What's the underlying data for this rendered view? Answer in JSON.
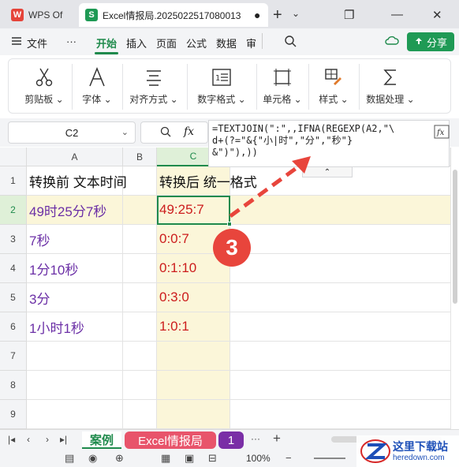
{
  "titlebar": {
    "wps_tab": "WPS Of",
    "doc_tab": "Excel情报局.2025022517080013",
    "modified_dot": "●",
    "new_tab": "+",
    "chevron": "⌄"
  },
  "menu": {
    "items": [
      "文件",
      "···",
      "开始",
      "插入",
      "页面",
      "公式",
      "数据",
      "审"
    ],
    "active": "开始",
    "share": "分享"
  },
  "ribbon": {
    "groups": [
      "剪贴板",
      "字体",
      "对齐方式",
      "数字格式",
      "单元格",
      "样式",
      "数据处理"
    ],
    "caret": "⌄"
  },
  "formula_bar": {
    "name_box": "C2",
    "formula_lines": [
      "=TEXTJOIN(\":\",,IFNA(REGEXP(A2,\"\\",
      "d+(?=\"&{\"小|时\",\"分\",\"秒\"}",
      "&\")\"),))"
    ],
    "zoom_icon": "🔍",
    "fx_icon": "fx",
    "collapse": "⌃"
  },
  "grid": {
    "columns": [
      "A",
      "B",
      "C"
    ],
    "rows": [
      "1",
      "2",
      "3",
      "4",
      "5",
      "6",
      "7",
      "8",
      "9"
    ],
    "header_a": "转换前 文本时间",
    "header_c": "转换后 统一格式",
    "data": [
      {
        "a": "49时25分7秒",
        "c": "49:25:7"
      },
      {
        "a": "7秒",
        "c": "0:0:7"
      },
      {
        "a": "1分10秒",
        "c": "0:1:10"
      },
      {
        "a": "3分",
        "c": "0:3:0"
      },
      {
        "a": "1小时1秒",
        "c": "1:0:1"
      }
    ],
    "selected_cell": "C2"
  },
  "annotation": {
    "badge": "3",
    "color": "#e8453c"
  },
  "sheets": {
    "tabs": [
      "案例",
      "Excel情报局",
      "1"
    ],
    "active": "案例",
    "add": "+"
  },
  "statusbar": {
    "zoom": "100%",
    "minus": "−",
    "plus": "+"
  },
  "watermark": {
    "line1": "这里下载站",
    "line2": "heredown.com"
  },
  "colors": {
    "accent": "#1f8a4c",
    "purple_text": "#6b2fa6",
    "red_text": "#cc1d1d",
    "selected_column": "#fbf6d9"
  }
}
